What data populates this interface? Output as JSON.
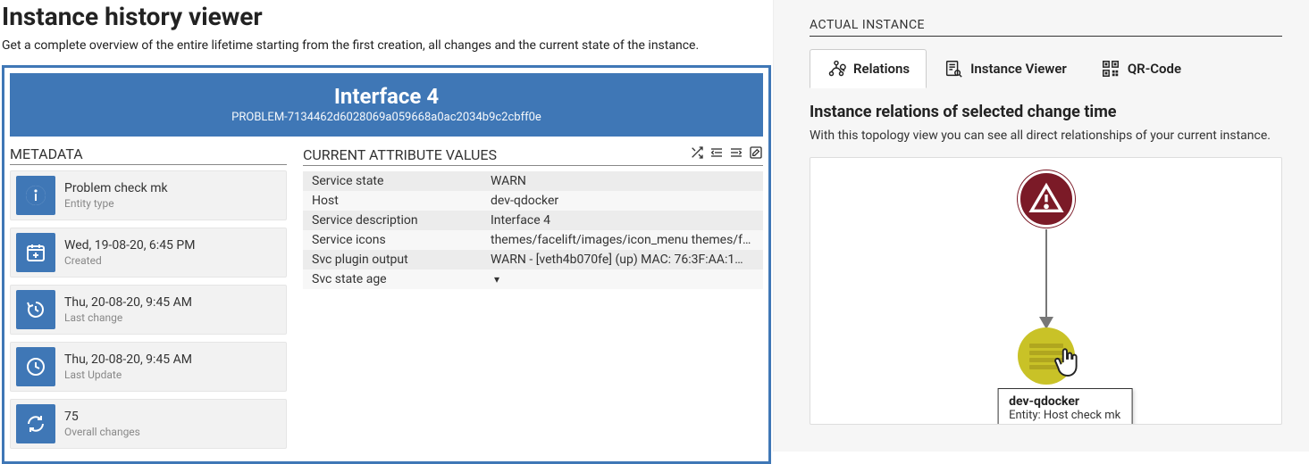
{
  "page": {
    "title": "Instance history viewer",
    "description": "Get a complete overview of the entire lifetime starting from the first creation, all changes and the current state of the instance."
  },
  "banner": {
    "title": "Interface 4",
    "subtitle": "PROBLEM-7134462d6028069a059668a0ac2034b9c2cbff0e"
  },
  "metadata": {
    "header": "METADATA",
    "items": [
      {
        "icon": "info",
        "value": "Problem check mk",
        "label": "Entity type"
      },
      {
        "icon": "calendar",
        "value": "Wed, 19-08-20, 6:45 PM",
        "label": "Created"
      },
      {
        "icon": "history",
        "value": "Thu, 20-08-20, 9:45 AM",
        "label": "Last change"
      },
      {
        "icon": "clock",
        "value": "Thu, 20-08-20, 9:45 AM",
        "label": "Last Update"
      },
      {
        "icon": "refresh",
        "value": "75",
        "label": "Overall changes"
      }
    ]
  },
  "attributes": {
    "header": "CURRENT ATTRIBUTE VALUES",
    "rows": [
      {
        "key": "Service state",
        "value": "WARN",
        "link": false
      },
      {
        "key": "Host",
        "value": "dev-qdocker",
        "link": false
      },
      {
        "key": "Service description",
        "value": "Interface 4",
        "link": false
      },
      {
        "key": "Service icons",
        "value": "themes/facelift/images/icon_menu themes/fac…",
        "link": false
      },
      {
        "key": "Svc plugin output",
        "value": "WARN - [veth4b070fe] (up) MAC: 76:3F:AA:1…",
        "link": true
      },
      {
        "key": "Svc state age",
        "value": "",
        "caret": true
      }
    ]
  },
  "right": {
    "actual_header": "ACTUAL INSTANCE",
    "tabs": [
      {
        "id": "relations",
        "label": "Relations",
        "active": true
      },
      {
        "id": "viewer",
        "label": "Instance Viewer",
        "active": false
      },
      {
        "id": "qr",
        "label": "QR-Code",
        "active": false
      }
    ],
    "relations_title": "Instance relations of selected change time",
    "relations_desc": "With this topology view you can see all direct relationships of your current instance.",
    "tooltip": {
      "title": "dev-qdocker",
      "sub": "Entity: Host check mk"
    }
  }
}
